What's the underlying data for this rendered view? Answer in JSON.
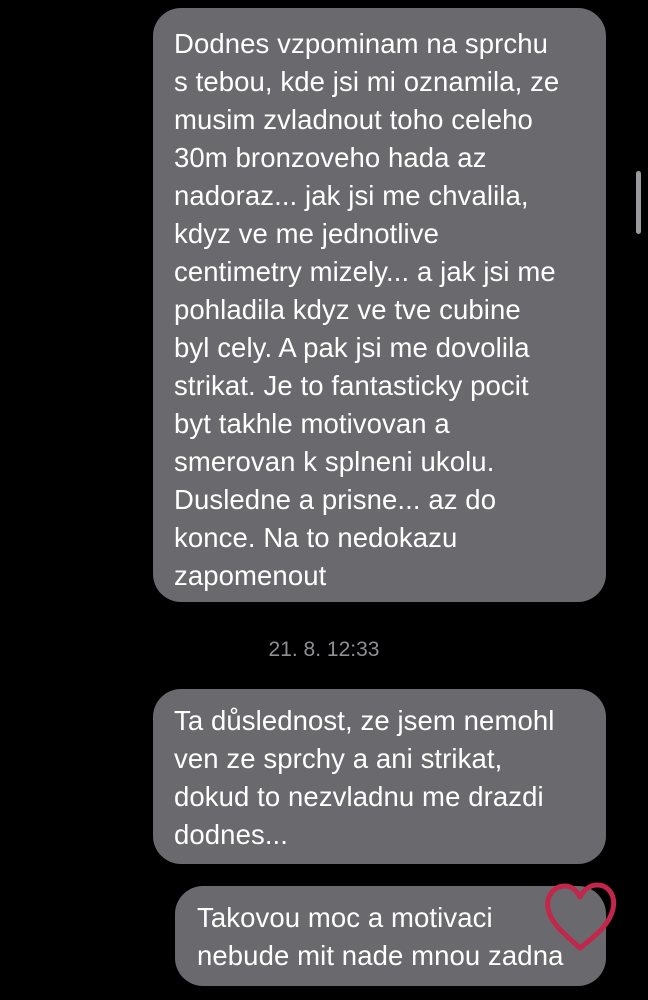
{
  "messages": [
    {
      "lines": [
        "Dodnes vzpominam na sprchu",
        "s tebou, kde jsi mi oznamila, ze",
        "musim zvladnout toho celeho",
        "30m bronzoveho hada az",
        "nadoraz... jak jsi me chvalila,",
        "kdyz ve me jednotlive",
        "centimetry mizely... a jak jsi me",
        "pohladila kdyz ve tve cubine",
        "byl cely. A pak jsi me dovolila",
        "strikat. Je to fantasticky pocit",
        "byt takhle motivovan a",
        "smerovan k splneni ukolu.",
        "Dusledne a prisne... az do",
        "konce. Na to nedokazu",
        "zapomenout"
      ]
    },
    {
      "lines": [
        "Ta důslednost, ze jsem nemohl",
        "ven ze sprchy a ani strikat,",
        "dokud to nezvladnu me drazdi",
        "dodnes..."
      ]
    },
    {
      "lines": [
        "Takovou moc a motivaci",
        "nebude mit nade mnou zadna"
      ]
    }
  ],
  "timestamp": "21. 8. 12:33",
  "colors": {
    "background": "#000000",
    "bubble": "#6a6a6e",
    "text": "#ffffff",
    "timestamp": "#8e8e93",
    "heart_stroke": "#c2264a"
  },
  "icons": {
    "heart": "heart-outline-icon"
  }
}
